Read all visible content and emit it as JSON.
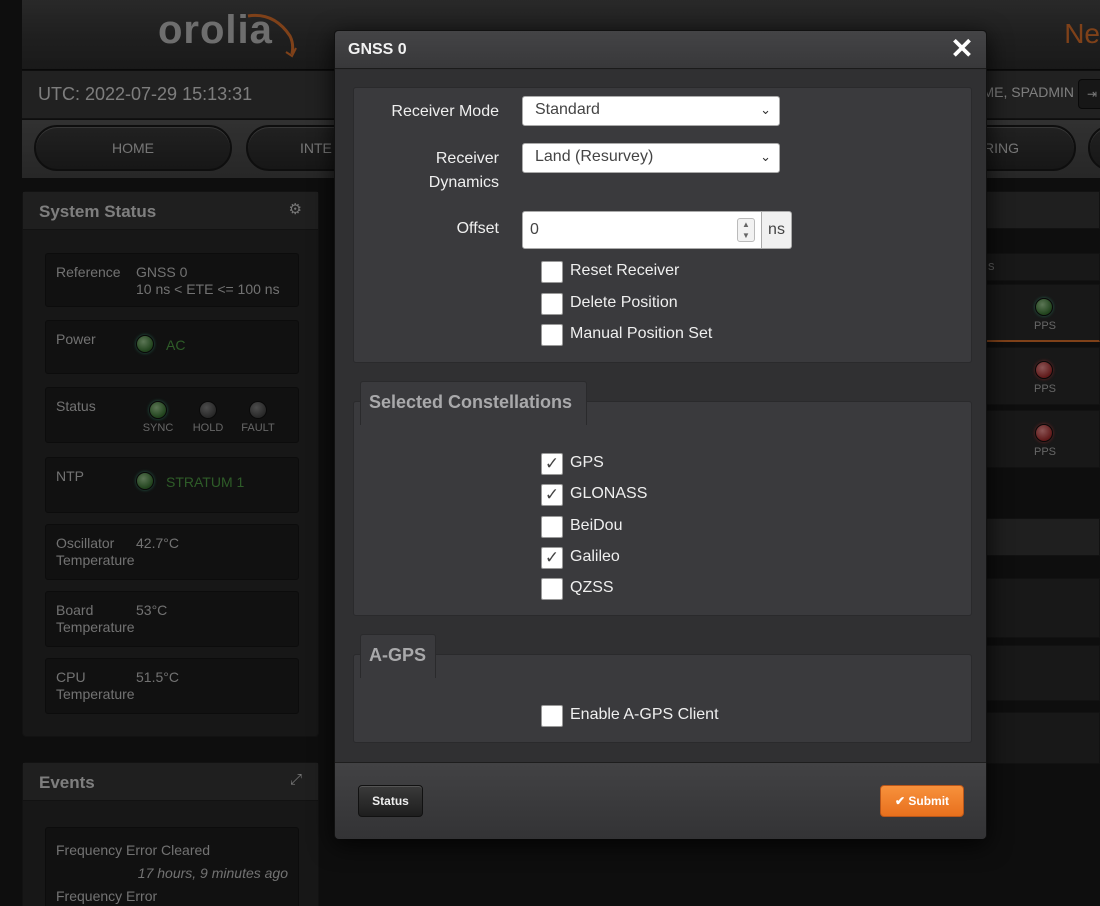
{
  "header": {
    "logo_text": "orolia",
    "title_fragment": "Ne"
  },
  "utc_bar": {
    "utc": "UTC: 2022-07-29 15:13:31",
    "user": "ME, SPADMIN",
    "logout_icon": "logout-icon"
  },
  "nav": {
    "home": "HOME",
    "interfaces": "INTE",
    "monitoring": "RING"
  },
  "system_status": {
    "title": "System Status",
    "settings_icon": "gear-icon",
    "reference_label": "Reference",
    "reference_value": "GNSS 0",
    "reference_detail": "10 ns < ETE <= 100 ns",
    "power_label": "Power",
    "power_value": "AC",
    "status_label": "Status",
    "status_leds": [
      "SYNC",
      "HOLD",
      "FAULT"
    ],
    "ntp_label": "NTP",
    "ntp_value": "STRATUM 1",
    "osc_label_1": "Oscillator",
    "osc_label_2": "Temperature",
    "osc_value": "42.7°C",
    "board_label_1": "Board",
    "board_label_2": "Temperature",
    "board_value": "53°C",
    "cpu_label_1": "CPU",
    "cpu_label_2": "Temperature",
    "cpu_value": "51.5°C"
  },
  "events": {
    "title": "Events",
    "expand_icon": "expand-icon",
    "item1": "Frequency Error Cleared",
    "item1_time": "17 hours, 9 minutes ago",
    "item2": "Frequency Error"
  },
  "right_panel": {
    "col_fragment": "s",
    "pps": [
      "PPS",
      "PPS",
      "PPS"
    ]
  },
  "modal": {
    "title": "GNSS 0",
    "close_icon": "close-icon",
    "receiver_mode_label": "Receiver Mode",
    "receiver_mode_value": "Standard",
    "receiver_dynamics_label_1": "Receiver",
    "receiver_dynamics_label_2": "Dynamics",
    "receiver_dynamics_value": "Land (Resurvey)",
    "offset_label": "Offset",
    "offset_value": "0",
    "offset_unit": "ns",
    "options": [
      {
        "label": "Reset Receiver",
        "checked": false
      },
      {
        "label": "Delete Position",
        "checked": false
      },
      {
        "label": "Manual Position Set",
        "checked": false
      }
    ],
    "constellations_title": "Selected Constellations",
    "constellations": [
      {
        "label": "GPS",
        "checked": true
      },
      {
        "label": "GLONASS",
        "checked": true
      },
      {
        "label": "BeiDou",
        "checked": false
      },
      {
        "label": "Galileo",
        "checked": true
      },
      {
        "label": "QZSS",
        "checked": false
      }
    ],
    "agps_title": "A-GPS",
    "agps_option": {
      "label": "Enable A-GPS Client",
      "checked": false
    },
    "status_button": "Status",
    "submit_button": "Submit",
    "submit_icon": "check-icon"
  },
  "colors": {
    "accent": "#e8772e",
    "submit": "#f28431",
    "ok_green": "#54a84a",
    "fault_red": "#c03a3a"
  }
}
